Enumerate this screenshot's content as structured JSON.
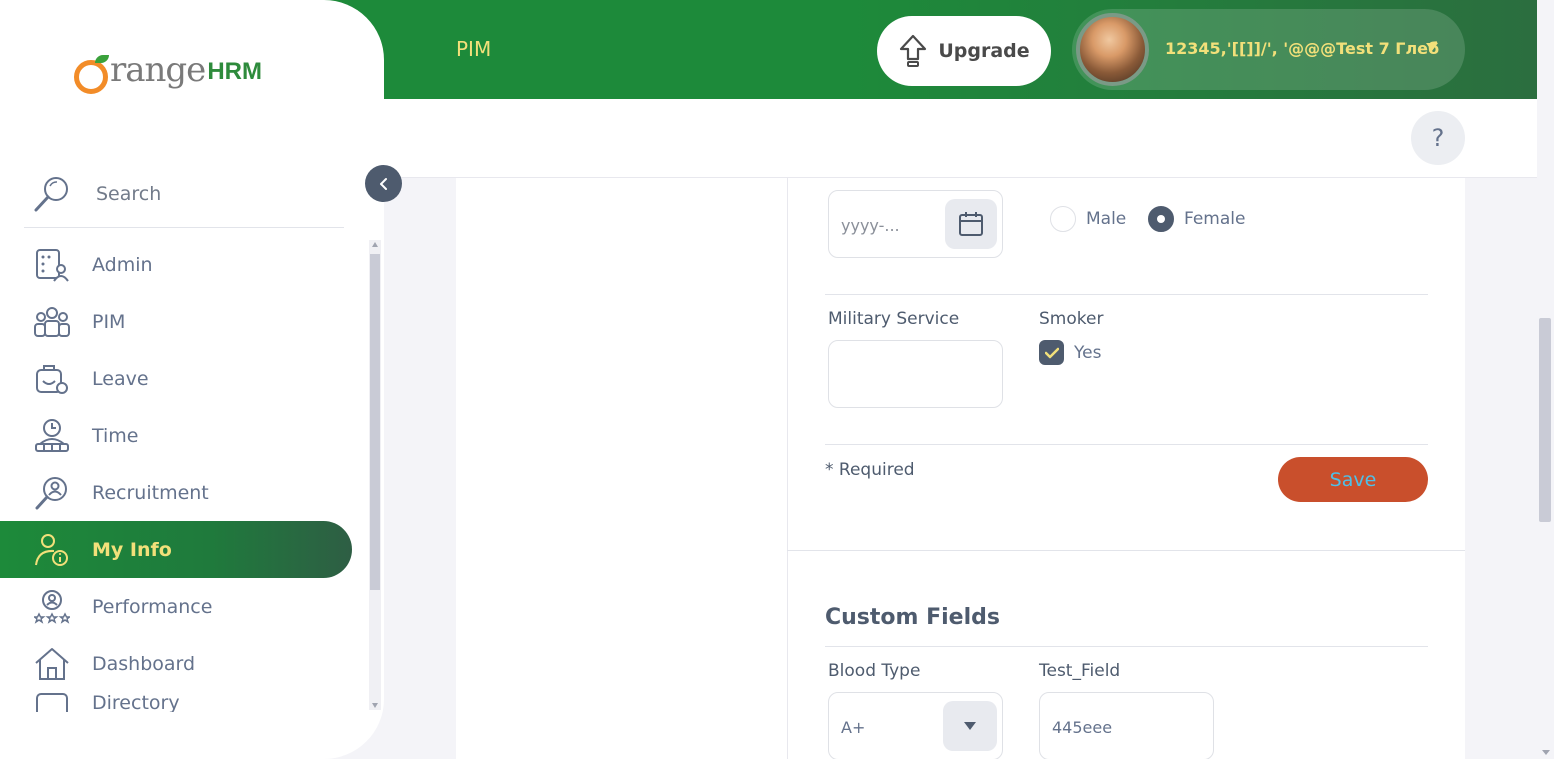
{
  "header": {
    "module_title": "PIM",
    "upgrade_label": "Upgrade",
    "user_name": "12345,'[[]]/', '@@@Test 7 Глеб",
    "help_label": "?"
  },
  "brand": {
    "logo_o": "O",
    "logo_range": "range",
    "logo_hrm": "HRM"
  },
  "sidebar": {
    "search_label": "Search",
    "items": [
      {
        "label": "Admin",
        "icon": "admin-icon"
      },
      {
        "label": "PIM",
        "icon": "pim-icon"
      },
      {
        "label": "Leave",
        "icon": "leave-icon"
      },
      {
        "label": "Time",
        "icon": "time-icon"
      },
      {
        "label": "Recruitment",
        "icon": "recruitment-icon"
      },
      {
        "label": "My Info",
        "icon": "my-info-icon",
        "active": true
      },
      {
        "label": "Performance",
        "icon": "performance-icon"
      },
      {
        "label": "Dashboard",
        "icon": "dashboard-icon"
      },
      {
        "label": "Directory",
        "icon": "directory-icon"
      }
    ]
  },
  "form": {
    "dob_placeholder": "yyyy-...",
    "gender_options": [
      "Male",
      "Female"
    ],
    "gender_selected": "Female",
    "military_label": "Military Service",
    "military_value": "",
    "smoker_label": "Smoker",
    "smoker_option": "Yes",
    "smoker_checked": true,
    "required_note": "* Required",
    "save_label": "Save"
  },
  "custom_fields": {
    "title": "Custom Fields",
    "blood_type_label": "Blood Type",
    "blood_type_value": "A+",
    "test_field_label": "Test_Field",
    "test_field_value": "445eee"
  },
  "colors": {
    "header_green": "#1d8a3a",
    "accent_yellow": "#f2e07a",
    "save_orange": "#c94f2c",
    "text_slate": "#64728c"
  }
}
